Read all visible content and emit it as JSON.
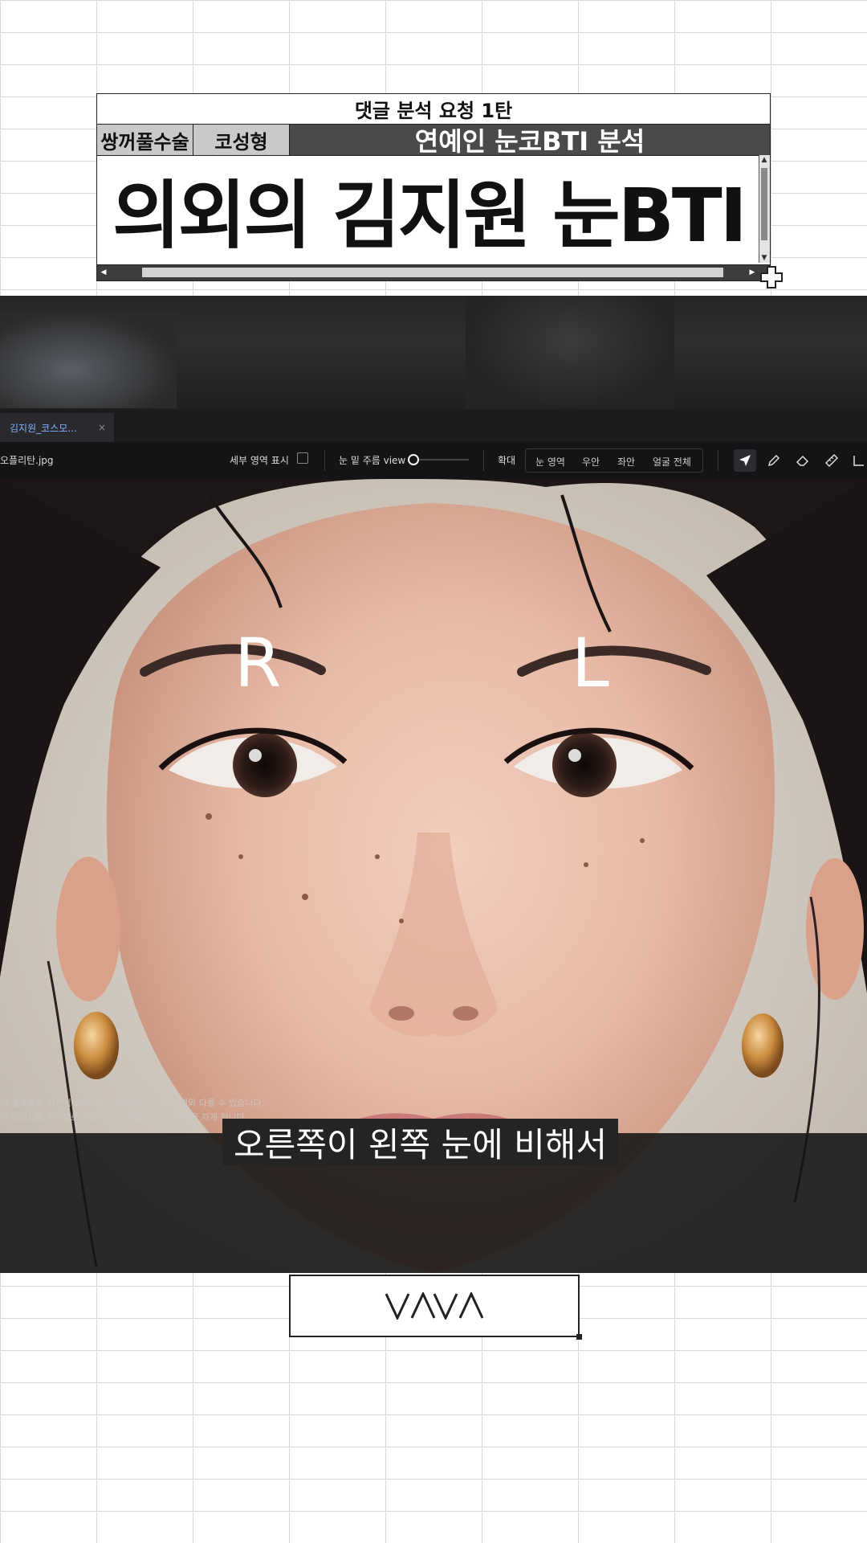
{
  "card": {
    "top_title": "댓글 분석 요청 1탄",
    "tag1": "쌍꺼풀수술",
    "tag2": "코성형",
    "tag3": "연예인 눈코BTI 분석",
    "main_title": "의외의 김지원 눈BTI"
  },
  "viewer": {
    "tab_label": "김지원_코스모...",
    "tab_close": "×",
    "file_name": "오플리탄.jpg",
    "detail_area_label": "세부 영역 표시",
    "wrinkle_view_label": "눈 밑 주름 view",
    "zoom_label": "확대",
    "zoom_options": [
      "눈 영역",
      "우안",
      "좌안",
      "얼굴 전체"
    ]
  },
  "photo": {
    "right_eye_marker": "R",
    "left_eye_marker": "L",
    "disclaimer_line1": "이 결과물은 AI분석 결과이며 사람마다 결과는 실제와 다를 수 있습니다.",
    "disclaimer_line2": "이 이미지를 무단으로 사용하거나 변형 시 법적 책임을 지게 됩니다."
  },
  "subtitle": "오른쪽이 왼쪽 눈에 비해서",
  "logo_text": "VAVA",
  "colors": {
    "tab_accent": "#7fb2ff",
    "header_dark": "#4a4a4a",
    "toolbar_bg": "#141416"
  },
  "icons": [
    "pointer-icon",
    "pencil-icon",
    "eraser-icon",
    "ruler-icon",
    "angle-icon",
    "close-icon",
    "cursor-plus-icon"
  ]
}
